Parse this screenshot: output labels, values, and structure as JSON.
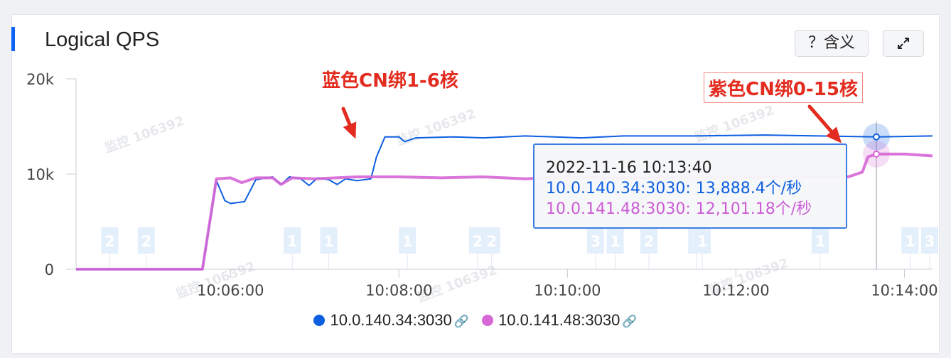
{
  "header": {
    "title": "Logical QPS",
    "meaning_button": "？含义",
    "expand_icon": "expand-icon"
  },
  "annotations": {
    "left": "蓝色CN绑1-6核",
    "right": "紫色CN绑0-15核"
  },
  "tooltip": {
    "time": "2022-11-16 10:13:40",
    "row_blue": "10.0.140.34:3030: 13,888.4个/秒",
    "row_purple": "10.0.141.48:3030: 12,101.18个/秒"
  },
  "legend": {
    "items": [
      {
        "label": "10.0.140.34:3030",
        "color": "#0d5fe0"
      },
      {
        "label": "10.0.141.48:3030",
        "color": "#d667d6"
      }
    ],
    "link_icon": "link-icon"
  },
  "watermark": "监控 106392",
  "chart_data": {
    "type": "line",
    "x_ticks": [
      "10:06:00",
      "10:08:00",
      "10:10:00",
      "10:12:00",
      "10:14:00"
    ],
    "y_ticks": [
      "0",
      "10k",
      "20k"
    ],
    "xlim": [
      "10:04:10",
      "10:14:20"
    ],
    "ylim": [
      0,
      20000
    ],
    "grid": false,
    "legend_position": "bottom",
    "hover_time": "10:13:40",
    "series": [
      {
        "name": "10.0.140.34:3030",
        "color": "#0d5fe0",
        "points": [
          [
            "10:04:10",
            0
          ],
          [
            "10:05:40",
            0
          ],
          [
            "10:05:50",
            9300
          ],
          [
            "10:05:56",
            7200
          ],
          [
            "10:06:00",
            6900
          ],
          [
            "10:06:10",
            7100
          ],
          [
            "10:06:18",
            9400
          ],
          [
            "10:06:30",
            9700
          ],
          [
            "10:06:36",
            8900
          ],
          [
            "10:06:42",
            9700
          ],
          [
            "10:06:50",
            9500
          ],
          [
            "10:06:56",
            8800
          ],
          [
            "10:07:02",
            9600
          ],
          [
            "10:07:10",
            9400
          ],
          [
            "10:07:16",
            8900
          ],
          [
            "10:07:22",
            9500
          ],
          [
            "10:07:30",
            9300
          ],
          [
            "10:07:40",
            9500
          ],
          [
            "10:07:44",
            11800
          ],
          [
            "10:07:50",
            13900
          ],
          [
            "10:08:00",
            13900
          ],
          [
            "10:08:04",
            13400
          ],
          [
            "10:08:12",
            13800
          ],
          [
            "10:08:40",
            13900
          ],
          [
            "10:09:00",
            13800
          ],
          [
            "10:09:30",
            14000
          ],
          [
            "10:10:10",
            13800
          ],
          [
            "10:10:40",
            14000
          ],
          [
            "10:11:30",
            14000
          ],
          [
            "10:12:20",
            14100
          ],
          [
            "10:13:00",
            14000
          ],
          [
            "10:13:40",
            13900
          ],
          [
            "10:14:20",
            14000
          ]
        ]
      },
      {
        "name": "10.0.141.48:3030",
        "color": "#d667d6",
        "points": [
          [
            "10:04:10",
            0
          ],
          [
            "10:05:40",
            0
          ],
          [
            "10:05:50",
            9500
          ],
          [
            "10:06:00",
            9600
          ],
          [
            "10:06:08",
            9100
          ],
          [
            "10:06:18",
            9600
          ],
          [
            "10:06:30",
            9600
          ],
          [
            "10:06:36",
            8900
          ],
          [
            "10:06:44",
            9600
          ],
          [
            "10:07:00",
            9500
          ],
          [
            "10:07:30",
            9700
          ],
          [
            "10:08:00",
            9700
          ],
          [
            "10:08:30",
            9600
          ],
          [
            "10:09:00",
            9700
          ],
          [
            "10:09:30",
            9500
          ],
          [
            "10:10:00",
            9700
          ],
          [
            "10:10:30",
            9600
          ],
          [
            "10:11:00",
            9600
          ],
          [
            "10:12:00",
            9700
          ],
          [
            "10:13:20",
            9700
          ],
          [
            "10:13:30",
            10200
          ],
          [
            "10:13:34",
            11800
          ],
          [
            "10:13:40",
            12100
          ],
          [
            "10:14:00",
            12100
          ],
          [
            "10:14:20",
            11900
          ]
        ]
      }
    ],
    "event_markers": [
      {
        "time": "10:04:34",
        "label": "2"
      },
      {
        "time": "10:05:00",
        "label": "2"
      },
      {
        "time": "10:06:44",
        "label": "1"
      },
      {
        "time": "10:07:10",
        "label": "1"
      },
      {
        "time": "10:08:06",
        "label": "1"
      },
      {
        "time": "10:08:56",
        "label": "2"
      },
      {
        "time": "10:09:06",
        "label": "2"
      },
      {
        "time": "10:10:20",
        "label": "3"
      },
      {
        "time": "10:10:34",
        "label": "1"
      },
      {
        "time": "10:10:58",
        "label": "2"
      },
      {
        "time": "10:11:32",
        "label": "1"
      },
      {
        "time": "10:11:36",
        "label": "1"
      },
      {
        "time": "10:13:00",
        "label": "1"
      },
      {
        "time": "10:14:04",
        "label": "1"
      },
      {
        "time": "10:14:18",
        "label": "3"
      }
    ]
  }
}
